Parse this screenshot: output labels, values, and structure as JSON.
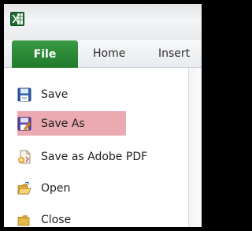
{
  "app": {
    "icon_name": "excel-icon",
    "accent": "#1f7a2b"
  },
  "ribbon": {
    "tabs": [
      {
        "label": "File",
        "active": true
      },
      {
        "label": "Home",
        "active": false
      },
      {
        "label": "Insert",
        "active": false
      }
    ]
  },
  "file_menu": {
    "items": [
      {
        "label": "Save",
        "icon": "floppy-disk-icon"
      },
      {
        "label": "Save As",
        "icon": "save-as-icon",
        "highlighted": true
      },
      {
        "label": "Save as Adobe PDF",
        "icon": "adobe-pdf-icon"
      },
      {
        "label": "Open",
        "icon": "open-folder-icon"
      },
      {
        "label": "Close",
        "icon": "close-folder-icon"
      }
    ],
    "highlight_color": "#eba9b1"
  }
}
